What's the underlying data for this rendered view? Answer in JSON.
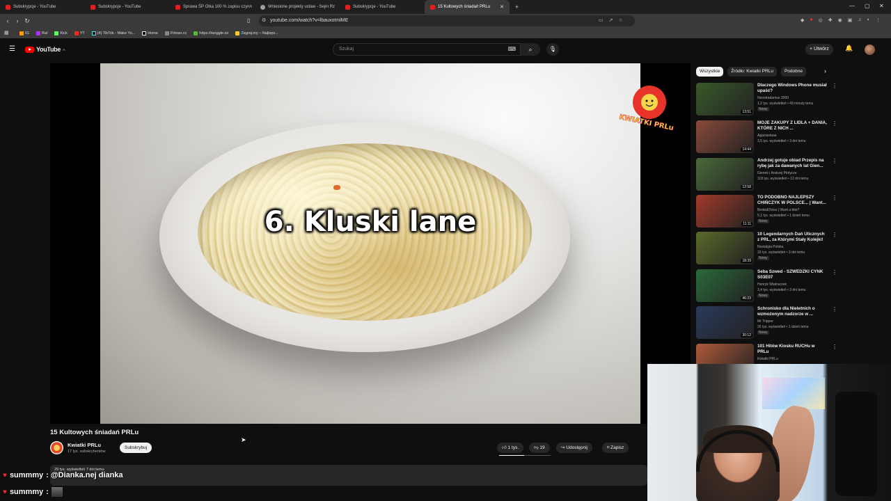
{
  "browser": {
    "tabs": [
      {
        "title": "Subskrypcje - YouTube",
        "icon": "youtube-icon"
      },
      {
        "title": "Subskrypcje - YouTube",
        "icon": "youtube-icon"
      },
      {
        "title": "Sprawa ŚP Olka 100 % zapisu czynn",
        "icon": "youtube-icon"
      },
      {
        "title": "Wniesione projekty ustaw - Sejm Rz",
        "icon": "globe-icon"
      },
      {
        "title": "Subskrypcje - YouTube",
        "icon": "youtube-icon"
      },
      {
        "title": "15 Kultowych śniadań PRLu",
        "icon": "youtube-icon",
        "active": true
      }
    ],
    "url": "youtube.com/watch?v=lbauxotmlME",
    "bookmarks": [
      "IG",
      "Rat",
      "Kick",
      "YT",
      "(4) TikTok - Make Yo...",
      "Home",
      "Filman.cc",
      "https://tanggle.io/",
      "Zagraj.my – Najleps..."
    ]
  },
  "header": {
    "logo_text": "YouTube",
    "logo_region": "PL",
    "search_placeholder": "Szukaj",
    "create_label": "Utwórz"
  },
  "video": {
    "overlay_text": "6. Kluski lane",
    "watermark_text": "KWIATKI PRLu",
    "title": "15 Kultowych śniadań PRLu",
    "channel_name": "Kwiatki PRLu",
    "channel_subs": "17 tys. subskrybentów",
    "subscribe_label": "Subskrybuj",
    "likes": "1 tys.",
    "dislikes": "19",
    "share_label": "Udostępnij",
    "save_label": "Zapisz",
    "views_line": "29 tys. wyświetleń  7 dni temu"
  },
  "chat": [
    {
      "user": "summmy",
      "text": ": @Dianka.nej dianka"
    },
    {
      "user": "summmy",
      "text": ":"
    }
  ],
  "sidebar": {
    "chips": [
      "Wszystkie",
      "Źródło: Kwiatki PRLu",
      "Podobne"
    ],
    "recommendations": [
      {
        "title": "Dlaczego Windows Phone musiał upaść?",
        "channel": "Neostradamus 2000",
        "meta": "1,2 tys. wyświetleń • 43 minuty temu",
        "badge": "Nowy",
        "duration": "13:51",
        "thumb": "#3a5a2a"
      },
      {
        "title": "MOJE ZAKUPY Z LIDLA + DANIA, KTÓRE Z NICH ...",
        "channel": "Agaciastaaa",
        "meta": "3,5 tys. wyświetleń • 3 dni temu",
        "badge": "",
        "duration": "14:44",
        "thumb": "#8a4a3a"
      },
      {
        "title": "Andrzej gotuje obiad Przepis na rybę jak za dawanych lat Gien...",
        "channel": "Gienek i Andrzej Płotycze",
        "meta": "118 tys. wyświetleń • 12 dni temu",
        "badge": "",
        "duration": "12:58",
        "thumb": "#4a6a3a"
      },
      {
        "title": "TO PODOBNO NAJLEPSZY CHIŃCZYK W POLSCE... | Want...",
        "channel": "Beata&Tetsu | Want a bite?",
        "meta": "5,1 tys. wyświetleń • 1 dzień temu",
        "badge": "Nowy",
        "duration": "11:11",
        "thumb": "#a33a2a"
      },
      {
        "title": "10 Legendarnych Dań Ulicznych z PRL, za Którymi Stały Kolejki!",
        "channel": "Nostalgia Polska",
        "meta": "33 tys. wyświetleń • 3 dni temu",
        "badge": "Nowy",
        "duration": "18:39",
        "thumb": "#5a6a2a"
      },
      {
        "title": "Seba Szwed - SZWEDZKI CYNK S03E07",
        "channel": "Henryk Wiatraczek",
        "meta": "3,4 tys. wyświetleń • 3 dni temu",
        "badge": "Nowy",
        "duration": "46:23",
        "thumb": "#2a6a3a"
      },
      {
        "title": "Schronisko dla Nieletnich o wzmożonym nadzorze w ...",
        "channel": "Mr Tripper",
        "meta": "26 tys. wyświetleń • 1 dzień temu",
        "badge": "Nowy",
        "duration": "30:12",
        "thumb": "#2a3a5a"
      },
      {
        "title": "101 Hitów Kiosku RUCHu w PRLu",
        "channel": "Kwiatki PRLu",
        "meta": "",
        "badge": "",
        "duration": "",
        "thumb": "#b05a3a"
      }
    ]
  }
}
